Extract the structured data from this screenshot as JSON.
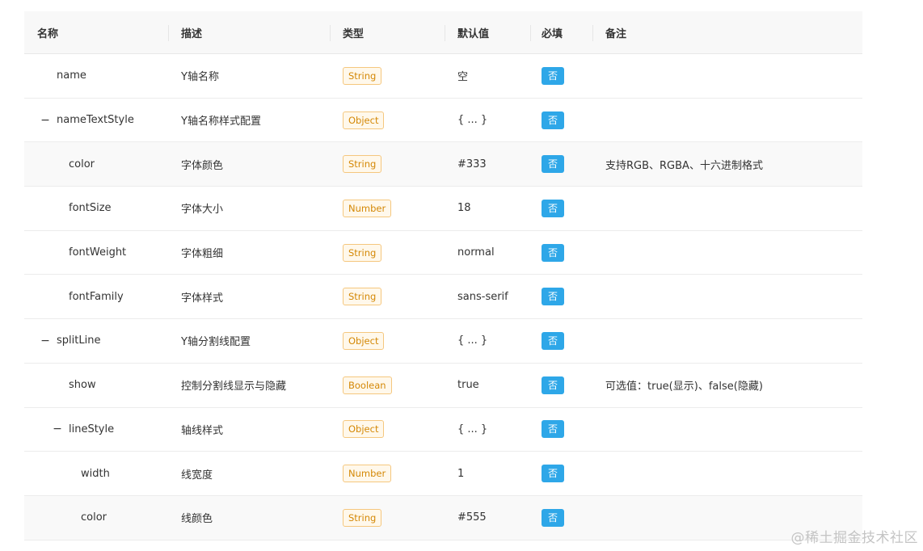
{
  "headers": {
    "name": "名称",
    "desc": "描述",
    "type": "类型",
    "default": "默认值",
    "required": "必填",
    "note": "备注"
  },
  "collapse_symbol": "−",
  "rows": [
    {
      "name": "name",
      "desc": "Y轴名称",
      "type": "String",
      "default": "空",
      "required": "否",
      "note": ""
    },
    {
      "name": "nameTextStyle",
      "desc": "Y轴名称样式配置",
      "type": "Object",
      "default": "{ ... }",
      "required": "否",
      "note": ""
    },
    {
      "name": "color",
      "desc": "字体颜色",
      "type": "String",
      "default": "#333",
      "required": "否",
      "note": "支持RGB、RGBA、十六进制格式"
    },
    {
      "name": "fontSize",
      "desc": "字体大小",
      "type": "Number",
      "default": "18",
      "required": "否",
      "note": ""
    },
    {
      "name": "fontWeight",
      "desc": "字体粗细",
      "type": "String",
      "default": "normal",
      "required": "否",
      "note": ""
    },
    {
      "name": "fontFamily",
      "desc": "字体样式",
      "type": "String",
      "default": "sans-serif",
      "required": "否",
      "note": ""
    },
    {
      "name": "splitLine",
      "desc": "Y轴分割线配置",
      "type": "Object",
      "default": "{ ... }",
      "required": "否",
      "note": ""
    },
    {
      "name": "show",
      "desc": "控制分割线显示与隐藏",
      "type": "Boolean",
      "default": "true",
      "required": "否",
      "note": "可选值：true(显示)、false(隐藏)"
    },
    {
      "name": "lineStyle",
      "desc": "轴线样式",
      "type": "Object",
      "default": "{ ... }",
      "required": "否",
      "note": ""
    },
    {
      "name": "width",
      "desc": "线宽度",
      "type": "Number",
      "default": "1",
      "required": "否",
      "note": ""
    },
    {
      "name": "color",
      "desc": "线颜色",
      "type": "String",
      "default": "#555",
      "required": "否",
      "note": ""
    }
  ],
  "watermark": "@稀土掘金技术社区",
  "colors": {
    "tag_border": "#f5c77e",
    "tag_text": "#d48806",
    "required_badge": "#2ea7e8",
    "header_bg": "#f8f8f8"
  }
}
